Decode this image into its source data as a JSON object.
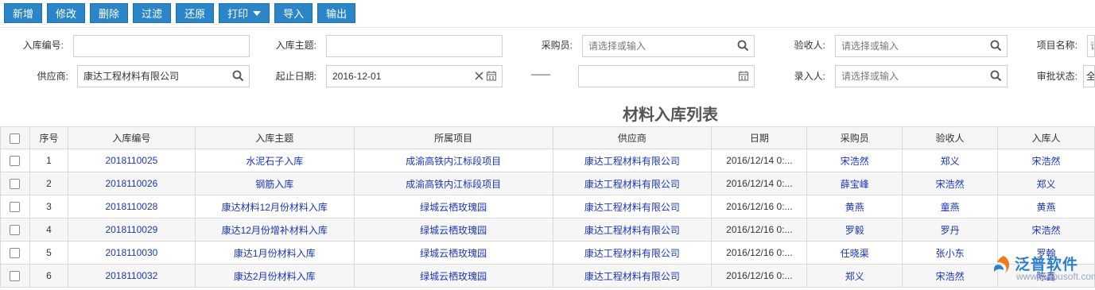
{
  "toolbar": {
    "add": "新增",
    "edit": "修改",
    "delete": "删除",
    "filter": "过滤",
    "restore": "还原",
    "print": "打印",
    "import": "导入",
    "export": "输出"
  },
  "filters": {
    "code_label": "入库编号:",
    "code_value": "",
    "subject_label": "入库主题:",
    "subject_value": "",
    "buyer_label": "采购员:",
    "buyer_placeholder": "请选择或输入",
    "inspector_label": "验收人:",
    "inspector_placeholder": "请选择或输入",
    "project_label": "项目名称:",
    "project_placeholder": "请",
    "supplier_label": "供应商:",
    "supplier_value": "康达工程材料有限公司",
    "date_label": "起止日期:",
    "date_start": "2016-12-01",
    "date_sep": "——",
    "date_end": "",
    "recorder_label": "录入人:",
    "recorder_placeholder": "请选择或输入",
    "approval_label": "审批状态:",
    "approval_value": "全"
  },
  "page_title": "材料入库列表",
  "table": {
    "headers": [
      "序号",
      "入库编号",
      "入库主题",
      "所属项目",
      "供应商",
      "日期",
      "采购员",
      "验收人",
      "入库人"
    ],
    "rows": [
      {
        "seq": "1",
        "code": "2018110025",
        "subject": "水泥石子入库",
        "project": "成渝高铁内江标段项目",
        "supplier": "康达工程材料有限公司",
        "date": "2016/12/14 0:...",
        "buyer": "宋浩然",
        "inspector": "郑义",
        "receiver": "宋浩然"
      },
      {
        "seq": "2",
        "code": "2018110026",
        "subject": "钢筋入库",
        "project": "成渝高铁内江标段项目",
        "supplier": "康达工程材料有限公司",
        "date": "2016/12/14 0:...",
        "buyer": "薛宝峰",
        "inspector": "宋浩然",
        "receiver": "郑义"
      },
      {
        "seq": "3",
        "code": "2018110028",
        "subject": "康达材料12月份材料入库",
        "project": "绿城云栖玫瑰园",
        "supplier": "康达工程材料有限公司",
        "date": "2016/12/16 0:...",
        "buyer": "黄燕",
        "inspector": "童燕",
        "receiver": "黄燕"
      },
      {
        "seq": "4",
        "code": "2018110029",
        "subject": "康达12月份增补材料入库",
        "project": "绿城云栖玫瑰园",
        "supplier": "康达工程材料有限公司",
        "date": "2016/12/16 0:...",
        "buyer": "罗毅",
        "inspector": "罗丹",
        "receiver": "宋浩然"
      },
      {
        "seq": "5",
        "code": "2018110030",
        "subject": "康达1月份材料入库",
        "project": "绿城云栖玫瑰园",
        "supplier": "康达工程材料有限公司",
        "date": "2016/12/16 0:...",
        "buyer": "任晓渠",
        "inspector": "张小东",
        "receiver": "罗翰"
      },
      {
        "seq": "6",
        "code": "2018110032",
        "subject": "康达2月份材料入库",
        "project": "绿城云栖玫瑰园",
        "supplier": "康达工程材料有限公司",
        "date": "2016/12/16 0:...",
        "buyer": "郑义",
        "inspector": "宋浩然",
        "receiver": "陈鑫"
      }
    ]
  },
  "watermark": {
    "brand": "泛普软件",
    "url": "www.fanpusoft.com"
  }
}
